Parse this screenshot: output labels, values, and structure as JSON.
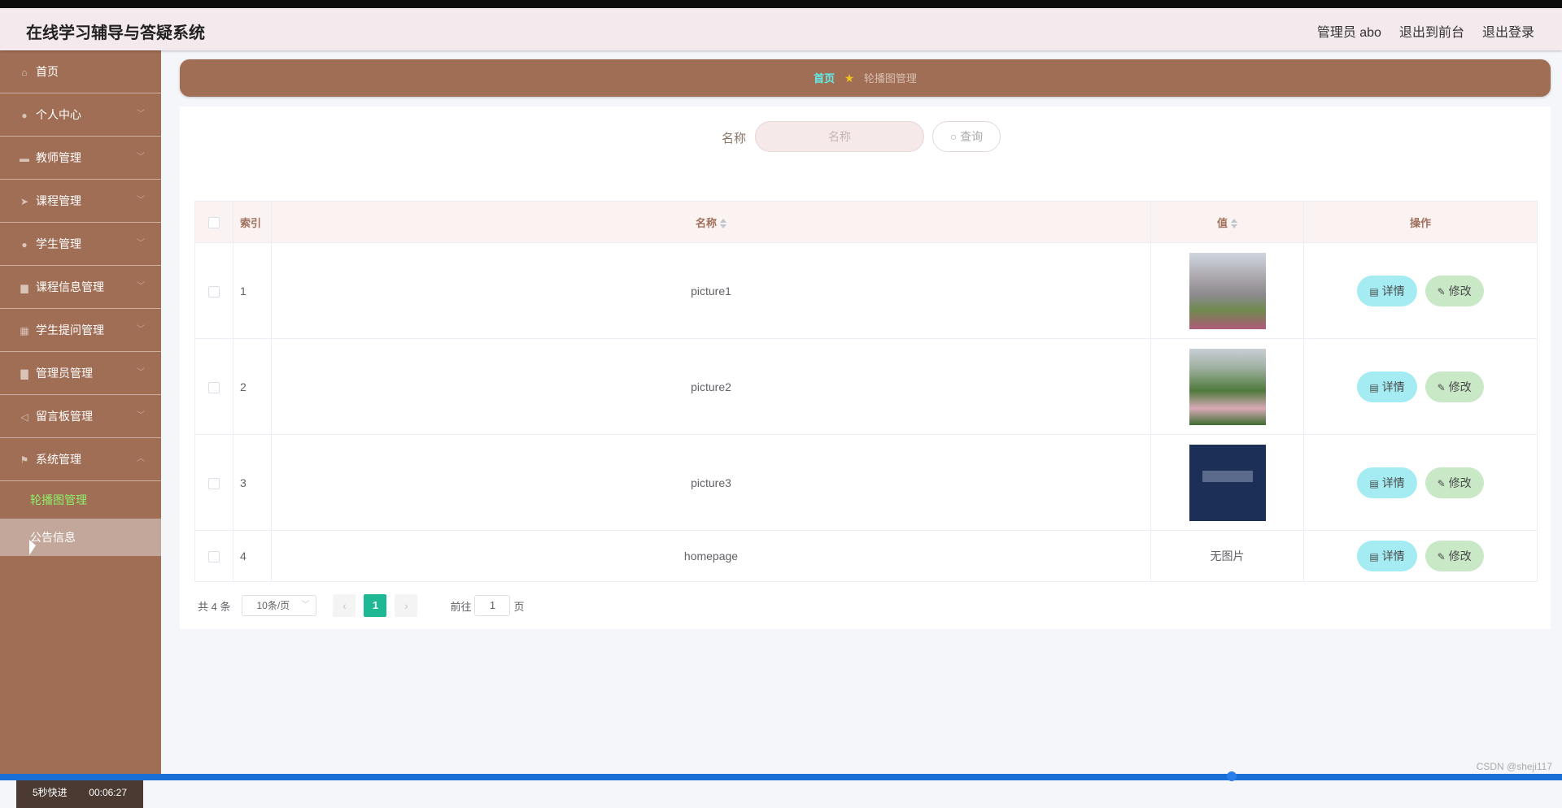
{
  "app": {
    "title": "在线学习辅导与答疑系统"
  },
  "header": {
    "user": "管理员 abo",
    "to_front": "退出到前台",
    "logout": "退出登录"
  },
  "sidebar": {
    "items": [
      {
        "label": "首页",
        "icon": "home-icon"
      },
      {
        "label": "个人中心",
        "icon": "user-icon"
      },
      {
        "label": "教师管理",
        "icon": "tablet-icon"
      },
      {
        "label": "课程管理",
        "icon": "send-icon"
      },
      {
        "label": "学生管理",
        "icon": "user-icon"
      },
      {
        "label": "课程信息管理",
        "icon": "chat-icon"
      },
      {
        "label": "学生提问管理",
        "icon": "grid-icon"
      },
      {
        "label": "管理员管理",
        "icon": "bar-chart-icon"
      },
      {
        "label": "留言板管理",
        "icon": "paper-plane-icon"
      },
      {
        "label": "系统管理",
        "icon": "flag-icon"
      }
    ],
    "sub_items": [
      {
        "label": "轮播图管理"
      },
      {
        "label": "公告信息"
      }
    ],
    "speed_label": "5秒快进",
    "timer": "00:06:27"
  },
  "breadcrumb": {
    "home": "首页",
    "current": "轮播图管理"
  },
  "search": {
    "label": "名称",
    "placeholder": "名称",
    "button": "查询"
  },
  "table": {
    "headers": {
      "index": "索引",
      "name": "名称",
      "value": "值",
      "actions": "操作"
    },
    "rows": [
      {
        "index": "1",
        "name": "picture1",
        "value": ""
      },
      {
        "index": "2",
        "name": "picture2",
        "value": ""
      },
      {
        "index": "3",
        "name": "picture3",
        "value": ""
      },
      {
        "index": "4",
        "name": "homepage",
        "value": "无图片"
      }
    ],
    "detail_label": "详情",
    "edit_label": "修改"
  },
  "pagination": {
    "total": "共 4 条",
    "page_size": "10条/页",
    "current_page": "1",
    "goto_label": "前往",
    "goto_value": "1",
    "page_suffix": "页"
  },
  "watermark": "CSDN @sheji117",
  "colors": {
    "sidebar": "#a06e55",
    "header": "#f4e9ec",
    "accent": "#5ef0ea",
    "active_submenu": "#8ef06a",
    "page_active": "#1fb895"
  }
}
